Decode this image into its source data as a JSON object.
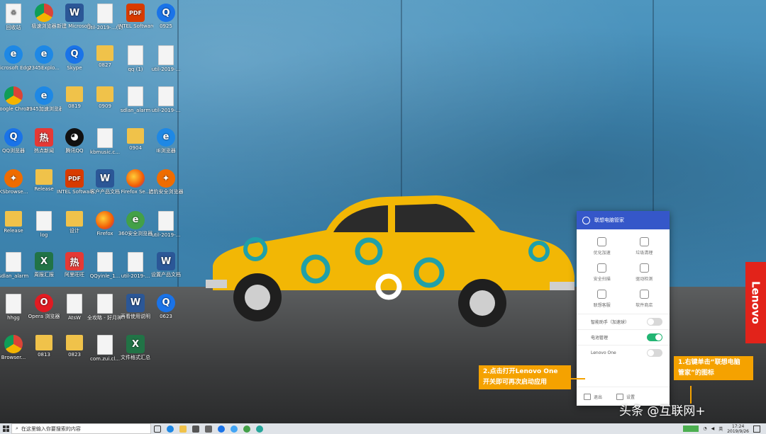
{
  "desktop": {
    "icons": [
      {
        "label": "回收站",
        "kind": "recycle"
      },
      {
        "label": "极速浏览器",
        "kind": "chrome"
      },
      {
        "label": "新建 Microsoft...",
        "kind": "word"
      },
      {
        "label": "util-2019-...(1)",
        "kind": "doc"
      },
      {
        "label": "INTEL Software...",
        "kind": "pdf"
      },
      {
        "label": "0925",
        "kind": "blue"
      },
      {
        "label": "Microsoft Edge",
        "kind": "ie"
      },
      {
        "label": "2345Explo...",
        "kind": "ie"
      },
      {
        "label": "Skype",
        "kind": "blue"
      },
      {
        "label": "0827",
        "kind": "folder"
      },
      {
        "label": "qq (1)",
        "kind": "doc"
      },
      {
        "label": "util-2019-...",
        "kind": "doc"
      },
      {
        "label": "Google Chrome",
        "kind": "chrome"
      },
      {
        "label": "2345加速浏览器",
        "kind": "ie"
      },
      {
        "label": "0819",
        "kind": "folder"
      },
      {
        "label": "0909",
        "kind": "folder"
      },
      {
        "label": "sdlan_alarm",
        "kind": "doc"
      },
      {
        "label": "util-2019-...",
        "kind": "doc"
      },
      {
        "label": "QQ浏览器",
        "kind": "blue"
      },
      {
        "label": "热点新闻",
        "kind": "red"
      },
      {
        "label": "腾讯QQ",
        "kind": "qq"
      },
      {
        "label": "kbmusic.c...",
        "kind": "doc"
      },
      {
        "label": "0904",
        "kind": "folder"
      },
      {
        "label": "IE浏览器",
        "kind": "ie"
      },
      {
        "label": "KSbrowse...",
        "kind": "orange"
      },
      {
        "label": "Release",
        "kind": "folder"
      },
      {
        "label": "INTEL Software...",
        "kind": "pdf"
      },
      {
        "label": "客户产品文档",
        "kind": "word"
      },
      {
        "label": "Firefox Se...",
        "kind": "firefox"
      },
      {
        "label": "猎豹安全浏览器",
        "kind": "orange"
      },
      {
        "label": "Release",
        "kind": "folder"
      },
      {
        "label": "log",
        "kind": "doc"
      },
      {
        "label": "设计",
        "kind": "folder"
      },
      {
        "label": "Firefox",
        "kind": "firefox"
      },
      {
        "label": "360安全浏览器",
        "kind": "green"
      },
      {
        "label": "util-2019-...",
        "kind": "doc"
      },
      {
        "label": "sdlan_alarm",
        "kind": "doc"
      },
      {
        "label": "周报汇报",
        "kind": "excel"
      },
      {
        "label": "阿里旺旺",
        "kind": "red"
      },
      {
        "label": "QQyinle_1...",
        "kind": "doc"
      },
      {
        "label": "util-2019-...",
        "kind": "doc"
      },
      {
        "label": "设置产品文档",
        "kind": "word"
      },
      {
        "label": "hhgg",
        "kind": "doc"
      },
      {
        "label": "Opera 浏览器",
        "kind": "opera"
      },
      {
        "label": "AtsW",
        "kind": "doc"
      },
      {
        "label": "全攻略 - 好月神秘(3) ...",
        "kind": "doc"
      },
      {
        "label": "再看使用说明",
        "kind": "word"
      },
      {
        "label": "0623",
        "kind": "blue"
      },
      {
        "label": "Browser...",
        "kind": "chrome"
      },
      {
        "label": "0813",
        "kind": "folder"
      },
      {
        "label": "0823",
        "kind": "folder"
      },
      {
        "label": "com.zui.cl...",
        "kind": "doc"
      },
      {
        "label": "文件格式汇总",
        "kind": "excel"
      }
    ]
  },
  "panel": {
    "title": "联想电脑管家",
    "tiles": [
      {
        "label": "优化加速",
        "icon": "speed-icon"
      },
      {
        "label": "垃圾清理",
        "icon": "trash-icon"
      },
      {
        "label": "安全扫描",
        "icon": "shield-icon"
      },
      {
        "label": "驱动检测",
        "icon": "driver-icon"
      },
      {
        "label": "联想客服",
        "icon": "headset-icon"
      },
      {
        "label": "软件商店",
        "icon": "store-icon"
      }
    ],
    "toggles": [
      {
        "label": "智能助手（加速球）",
        "on": false
      },
      {
        "label": "电池管理",
        "on": true
      },
      {
        "label": "Lenovo One",
        "on": false
      }
    ],
    "footer": {
      "exit": "退出",
      "settings": "设置"
    }
  },
  "callouts": {
    "left": "2.点击打开Lenovo One\n开关即可再次启动应用",
    "right": "1.右键单击“联想电脑\n管家”的图标"
  },
  "lenovo_badge": "Lenovo",
  "watermark": "头条 @互联网+",
  "taskbar": {
    "search_placeholder": "在这里输入你要搜索的内容",
    "ime": "英",
    "time": "17:24",
    "date": "2019/9/26"
  },
  "colors": {
    "panel_header": "#3557c9",
    "toggle_on": "#22b573",
    "callout": "#f5a200",
    "lenovo_red": "#e2231a"
  }
}
